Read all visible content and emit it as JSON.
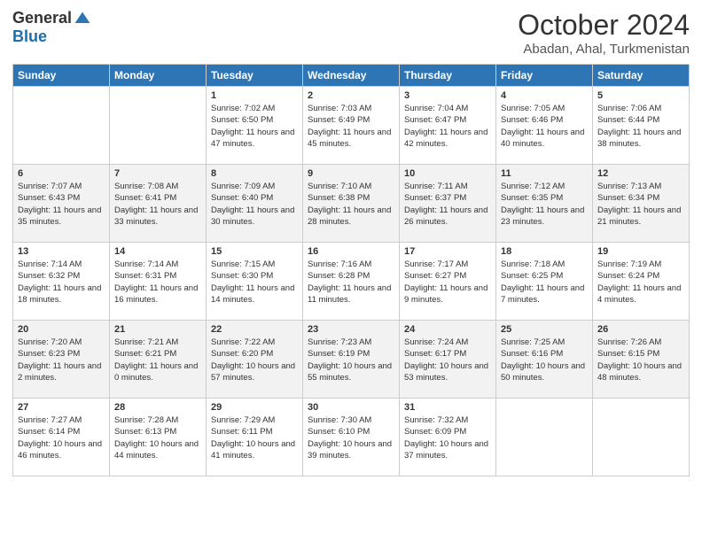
{
  "header": {
    "logo_general": "General",
    "logo_blue": "Blue",
    "month_title": "October 2024",
    "location": "Abadan, Ahal, Turkmenistan"
  },
  "days_of_week": [
    "Sunday",
    "Monday",
    "Tuesday",
    "Wednesday",
    "Thursday",
    "Friday",
    "Saturday"
  ],
  "weeks": [
    [
      {
        "day": "",
        "sunrise": "",
        "sunset": "",
        "daylight": ""
      },
      {
        "day": "",
        "sunrise": "",
        "sunset": "",
        "daylight": ""
      },
      {
        "day": "1",
        "sunrise": "Sunrise: 7:02 AM",
        "sunset": "Sunset: 6:50 PM",
        "daylight": "Daylight: 11 hours and 47 minutes."
      },
      {
        "day": "2",
        "sunrise": "Sunrise: 7:03 AM",
        "sunset": "Sunset: 6:49 PM",
        "daylight": "Daylight: 11 hours and 45 minutes."
      },
      {
        "day": "3",
        "sunrise": "Sunrise: 7:04 AM",
        "sunset": "Sunset: 6:47 PM",
        "daylight": "Daylight: 11 hours and 42 minutes."
      },
      {
        "day": "4",
        "sunrise": "Sunrise: 7:05 AM",
        "sunset": "Sunset: 6:46 PM",
        "daylight": "Daylight: 11 hours and 40 minutes."
      },
      {
        "day": "5",
        "sunrise": "Sunrise: 7:06 AM",
        "sunset": "Sunset: 6:44 PM",
        "daylight": "Daylight: 11 hours and 38 minutes."
      }
    ],
    [
      {
        "day": "6",
        "sunrise": "Sunrise: 7:07 AM",
        "sunset": "Sunset: 6:43 PM",
        "daylight": "Daylight: 11 hours and 35 minutes."
      },
      {
        "day": "7",
        "sunrise": "Sunrise: 7:08 AM",
        "sunset": "Sunset: 6:41 PM",
        "daylight": "Daylight: 11 hours and 33 minutes."
      },
      {
        "day": "8",
        "sunrise": "Sunrise: 7:09 AM",
        "sunset": "Sunset: 6:40 PM",
        "daylight": "Daylight: 11 hours and 30 minutes."
      },
      {
        "day": "9",
        "sunrise": "Sunrise: 7:10 AM",
        "sunset": "Sunset: 6:38 PM",
        "daylight": "Daylight: 11 hours and 28 minutes."
      },
      {
        "day": "10",
        "sunrise": "Sunrise: 7:11 AM",
        "sunset": "Sunset: 6:37 PM",
        "daylight": "Daylight: 11 hours and 26 minutes."
      },
      {
        "day": "11",
        "sunrise": "Sunrise: 7:12 AM",
        "sunset": "Sunset: 6:35 PM",
        "daylight": "Daylight: 11 hours and 23 minutes."
      },
      {
        "day": "12",
        "sunrise": "Sunrise: 7:13 AM",
        "sunset": "Sunset: 6:34 PM",
        "daylight": "Daylight: 11 hours and 21 minutes."
      }
    ],
    [
      {
        "day": "13",
        "sunrise": "Sunrise: 7:14 AM",
        "sunset": "Sunset: 6:32 PM",
        "daylight": "Daylight: 11 hours and 18 minutes."
      },
      {
        "day": "14",
        "sunrise": "Sunrise: 7:14 AM",
        "sunset": "Sunset: 6:31 PM",
        "daylight": "Daylight: 11 hours and 16 minutes."
      },
      {
        "day": "15",
        "sunrise": "Sunrise: 7:15 AM",
        "sunset": "Sunset: 6:30 PM",
        "daylight": "Daylight: 11 hours and 14 minutes."
      },
      {
        "day": "16",
        "sunrise": "Sunrise: 7:16 AM",
        "sunset": "Sunset: 6:28 PM",
        "daylight": "Daylight: 11 hours and 11 minutes."
      },
      {
        "day": "17",
        "sunrise": "Sunrise: 7:17 AM",
        "sunset": "Sunset: 6:27 PM",
        "daylight": "Daylight: 11 hours and 9 minutes."
      },
      {
        "day": "18",
        "sunrise": "Sunrise: 7:18 AM",
        "sunset": "Sunset: 6:25 PM",
        "daylight": "Daylight: 11 hours and 7 minutes."
      },
      {
        "day": "19",
        "sunrise": "Sunrise: 7:19 AM",
        "sunset": "Sunset: 6:24 PM",
        "daylight": "Daylight: 11 hours and 4 minutes."
      }
    ],
    [
      {
        "day": "20",
        "sunrise": "Sunrise: 7:20 AM",
        "sunset": "Sunset: 6:23 PM",
        "daylight": "Daylight: 11 hours and 2 minutes."
      },
      {
        "day": "21",
        "sunrise": "Sunrise: 7:21 AM",
        "sunset": "Sunset: 6:21 PM",
        "daylight": "Daylight: 11 hours and 0 minutes."
      },
      {
        "day": "22",
        "sunrise": "Sunrise: 7:22 AM",
        "sunset": "Sunset: 6:20 PM",
        "daylight": "Daylight: 10 hours and 57 minutes."
      },
      {
        "day": "23",
        "sunrise": "Sunrise: 7:23 AM",
        "sunset": "Sunset: 6:19 PM",
        "daylight": "Daylight: 10 hours and 55 minutes."
      },
      {
        "day": "24",
        "sunrise": "Sunrise: 7:24 AM",
        "sunset": "Sunset: 6:17 PM",
        "daylight": "Daylight: 10 hours and 53 minutes."
      },
      {
        "day": "25",
        "sunrise": "Sunrise: 7:25 AM",
        "sunset": "Sunset: 6:16 PM",
        "daylight": "Daylight: 10 hours and 50 minutes."
      },
      {
        "day": "26",
        "sunrise": "Sunrise: 7:26 AM",
        "sunset": "Sunset: 6:15 PM",
        "daylight": "Daylight: 10 hours and 48 minutes."
      }
    ],
    [
      {
        "day": "27",
        "sunrise": "Sunrise: 7:27 AM",
        "sunset": "Sunset: 6:14 PM",
        "daylight": "Daylight: 10 hours and 46 minutes."
      },
      {
        "day": "28",
        "sunrise": "Sunrise: 7:28 AM",
        "sunset": "Sunset: 6:13 PM",
        "daylight": "Daylight: 10 hours and 44 minutes."
      },
      {
        "day": "29",
        "sunrise": "Sunrise: 7:29 AM",
        "sunset": "Sunset: 6:11 PM",
        "daylight": "Daylight: 10 hours and 41 minutes."
      },
      {
        "day": "30",
        "sunrise": "Sunrise: 7:30 AM",
        "sunset": "Sunset: 6:10 PM",
        "daylight": "Daylight: 10 hours and 39 minutes."
      },
      {
        "day": "31",
        "sunrise": "Sunrise: 7:32 AM",
        "sunset": "Sunset: 6:09 PM",
        "daylight": "Daylight: 10 hours and 37 minutes."
      },
      {
        "day": "",
        "sunrise": "",
        "sunset": "",
        "daylight": ""
      },
      {
        "day": "",
        "sunrise": "",
        "sunset": "",
        "daylight": ""
      }
    ]
  ]
}
